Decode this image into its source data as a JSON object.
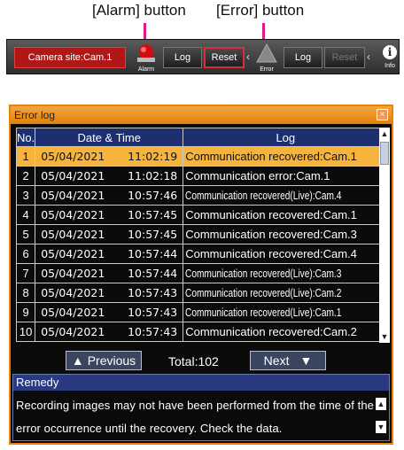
{
  "callouts": {
    "alarm": "[Alarm] button",
    "error": "[Error] button"
  },
  "status_bar": {
    "camera_site": "Camera site:Cam.1",
    "alarm_caption": "Alarm",
    "alarm_log": "Log",
    "alarm_reset": "Reset",
    "error_caption": "Error",
    "error_log": "Log",
    "error_reset": "Reset",
    "info_caption": "Info",
    "separator": "‹",
    "colors": {
      "camera_site_bg": "#b01818",
      "reset_border": "#d8303a",
      "alarm_light": "#d01010"
    }
  },
  "error_log": {
    "title": "Error log",
    "close_icon": "×",
    "columns": [
      "No.",
      "Date & Time",
      "Log"
    ],
    "rows": [
      {
        "no": "1",
        "date": "05/04/2021",
        "time": "11:02:19",
        "log": "Communication recovered:Cam.1",
        "narrow": false,
        "selected": true
      },
      {
        "no": "2",
        "date": "05/04/2021",
        "time": "11:02:18",
        "log": "Communication error:Cam.1",
        "narrow": false,
        "selected": false
      },
      {
        "no": "3",
        "date": "05/04/2021",
        "time": "10:57:46",
        "log": "Communication recovered(Live):Cam.4",
        "narrow": true,
        "selected": false
      },
      {
        "no": "4",
        "date": "05/04/2021",
        "time": "10:57:45",
        "log": "Communication recovered:Cam.1",
        "narrow": false,
        "selected": false
      },
      {
        "no": "5",
        "date": "05/04/2021",
        "time": "10:57:45",
        "log": "Communication recovered:Cam.3",
        "narrow": false,
        "selected": false
      },
      {
        "no": "6",
        "date": "05/04/2021",
        "time": "10:57:44",
        "log": "Communication recovered:Cam.4",
        "narrow": false,
        "selected": false
      },
      {
        "no": "7",
        "date": "05/04/2021",
        "time": "10:57:44",
        "log": "Communication recovered(Live):Cam.3",
        "narrow": true,
        "selected": false
      },
      {
        "no": "8",
        "date": "05/04/2021",
        "time": "10:57:43",
        "log": "Communication recovered(Live):Cam.2",
        "narrow": true,
        "selected": false
      },
      {
        "no": "9",
        "date": "05/04/2021",
        "time": "10:57:43",
        "log": "Communication recovered(Live):Cam.1",
        "narrow": true,
        "selected": false
      },
      {
        "no": "10",
        "date": "05/04/2021",
        "time": "10:57:43",
        "log": "Communication recovered:Cam.2",
        "narrow": false,
        "selected": false
      }
    ],
    "scroll_up": "▲",
    "scroll_down": "▼",
    "previous": "Previous",
    "previous_icon": "▲",
    "total": "Total:102",
    "next": "Next",
    "next_icon": "▼",
    "remedy_title": "Remedy",
    "remedy_text": "Recording images may not have been performed from the time of the error occurrence until the recovery. Check the data.",
    "colors": {
      "window_border": "#e8830e",
      "selected_row": "#f6b43c",
      "header_bg": "#1d2f6e"
    }
  }
}
